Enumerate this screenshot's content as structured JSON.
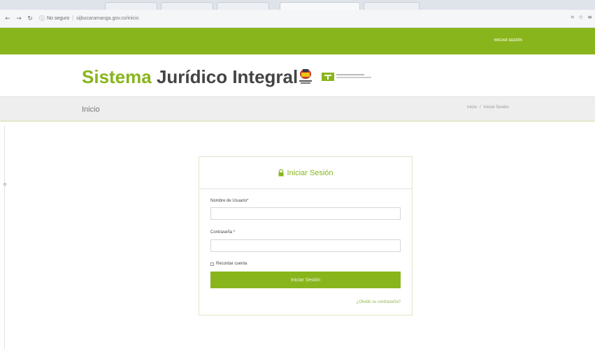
{
  "browser": {
    "address": {
      "security_label": "No seguro",
      "url": "sijbucaramanga.gov.co/inicio"
    }
  },
  "site": {
    "nav": {
      "login_label": "INICIAR SESIÓN"
    },
    "brand": {
      "part1": "Sistema",
      "part2": "Jurídico Integral"
    },
    "subheader": {
      "title": "Inicio",
      "breadcrumb": [
        "Inicio",
        "/",
        "Iniciar Sesión"
      ]
    }
  },
  "login": {
    "title": "Iniciar Sesión",
    "username_label": "Nombre de Usuario",
    "username_value": "",
    "password_label": "Contraseña",
    "password_value": "",
    "required_mark": "*",
    "remember_label": "Recordar cuenta",
    "remember_checked": false,
    "submit_label": "Iniciar Sesión",
    "forgot_label": "¿Olvidó su contraseña?"
  },
  "colors": {
    "brand_green": "#88b51c",
    "text_dark": "#444444",
    "subbar_bg": "#eeeeee"
  }
}
